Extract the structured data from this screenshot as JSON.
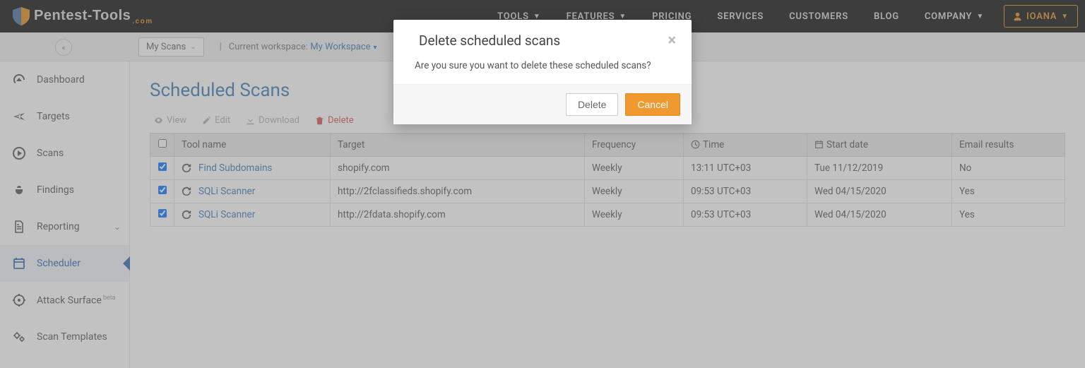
{
  "brand": {
    "name": "Pentest-Tools",
    "suffix": ".com"
  },
  "topnav": {
    "tools": "TOOLS",
    "features": "FEATURES",
    "pricing": "PRICING",
    "services": "SERVICES",
    "customers": "CUSTOMERS",
    "blog": "BLOG",
    "company": "COMPANY"
  },
  "user": {
    "name": "IOANA"
  },
  "subbar": {
    "my_scans": "My Scans",
    "cw_label": "Current workspace:",
    "workspace": "My Workspace"
  },
  "sidebar": {
    "dashboard": "Dashboard",
    "targets": "Targets",
    "scans": "Scans",
    "findings": "Findings",
    "reporting": "Reporting",
    "scheduler": "Scheduler",
    "attack_surface": "Attack Surface",
    "attack_surface_badge": "beta",
    "scan_templates": "Scan Templates"
  },
  "page": {
    "title": "Scheduled Scans"
  },
  "actions": {
    "view": "View",
    "edit": "Edit",
    "download": "Download",
    "delete": "Delete"
  },
  "columns": {
    "tool_name": "Tool name",
    "target": "Target",
    "frequency": "Frequency",
    "time": "Time",
    "start_date": "Start date",
    "email_results": "Email results"
  },
  "rows": [
    {
      "tool": "Find Subdomains",
      "target": "shopify.com",
      "frequency": "Weekly",
      "time": "13:11 UTC+03",
      "start_date": "Tue 11/12/2019",
      "email_results": "No"
    },
    {
      "tool": "SQLi Scanner",
      "target": "http://2fclassifieds.shopify.com",
      "frequency": "Weekly",
      "time": "09:53 UTC+03",
      "start_date": "Wed 04/15/2020",
      "email_results": "Yes"
    },
    {
      "tool": "SQLi Scanner",
      "target": "http://2fdata.shopify.com",
      "frequency": "Weekly",
      "time": "09:53 UTC+03",
      "start_date": "Wed 04/15/2020",
      "email_results": "Yes"
    }
  ],
  "modal": {
    "title": "Delete scheduled scans",
    "body": "Are you sure you want to delete these scheduled scans?",
    "delete": "Delete",
    "cancel": "Cancel"
  }
}
